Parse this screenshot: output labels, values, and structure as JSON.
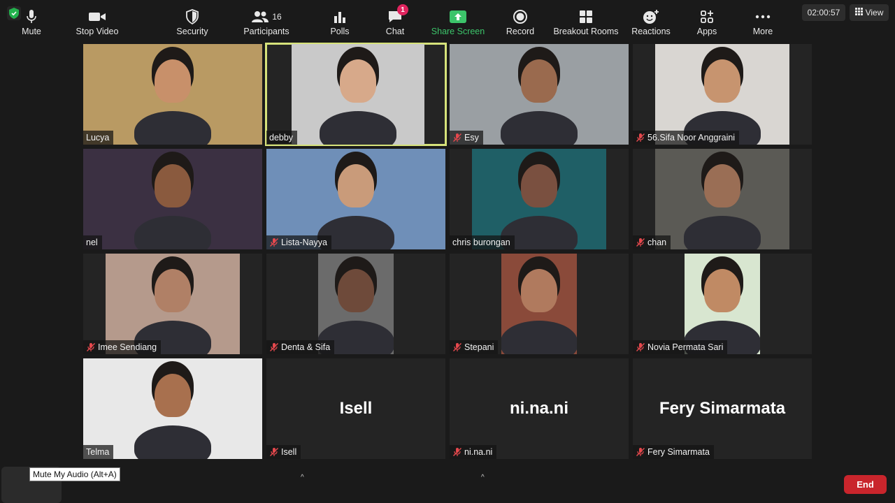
{
  "meeting": {
    "timer": "02:00:57",
    "view_label": "View"
  },
  "participants": [
    {
      "name": "Lucya",
      "muted": false,
      "video": true,
      "bg": "#b99a63"
    },
    {
      "name": "debby",
      "muted": false,
      "video": true,
      "active": true,
      "bg": "#c9c9c9"
    },
    {
      "name": "Esy",
      "muted": true,
      "video": true,
      "bg": "#9a9fa3"
    },
    {
      "name": "56.Sifa Noor Anggraini",
      "muted": true,
      "video": true,
      "bg": "#d9d6d2"
    },
    {
      "name": "nel",
      "muted": false,
      "video": true,
      "bg": "#3b3042"
    },
    {
      "name": "Lista-Nayya",
      "muted": true,
      "video": true,
      "bg": "#6f8fb8"
    },
    {
      "name": "chris burongan",
      "muted": false,
      "video": true,
      "bg": "#1f5f66"
    },
    {
      "name": "chan",
      "muted": true,
      "video": true,
      "bg": "#5b5a55"
    },
    {
      "name": "Imee Sendiang",
      "muted": true,
      "video": true,
      "bg": "#b59a8c"
    },
    {
      "name": "Denta & Sifa",
      "muted": true,
      "video": true,
      "bg": "#6b6b6b"
    },
    {
      "name": "Stepani",
      "muted": true,
      "video": true,
      "bg": "#8a4a3a"
    },
    {
      "name": "Novia Permata Sari",
      "muted": true,
      "video": true,
      "bg": "#d8e6d0"
    },
    {
      "name": "Telma",
      "muted": false,
      "video": true,
      "bg": "#e8e8e8"
    },
    {
      "name": "Isell",
      "muted": true,
      "video": false
    },
    {
      "name": "ni.na.ni",
      "muted": true,
      "video": false
    },
    {
      "name": "Fery Simarmata",
      "muted": true,
      "video": false
    }
  ],
  "toolbar": {
    "mute": "Mute",
    "mute_tooltip": "Mute My Audio (Alt+A)",
    "stop_video": "Stop Video",
    "security": "Security",
    "participants": "Participants",
    "participants_count": "16",
    "polls": "Polls",
    "chat": "Chat",
    "chat_badge": "1",
    "share_screen": "Share Screen",
    "record": "Record",
    "breakout_rooms": "Breakout Rooms",
    "reactions": "Reactions",
    "apps": "Apps",
    "more": "More",
    "end": "End"
  },
  "colors": {
    "accent_green": "#3cc46a",
    "end_red": "#c9252c",
    "active_speaker": "#d6e27a"
  }
}
